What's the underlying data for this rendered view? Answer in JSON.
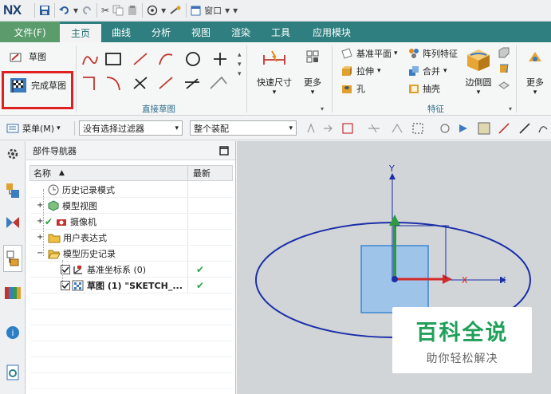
{
  "app": {
    "logo": "NX"
  },
  "quick_access": {
    "window_menu": "窗口"
  },
  "tabs": [
    {
      "label": "文件(F)"
    },
    {
      "label": "主页"
    },
    {
      "label": "曲线"
    },
    {
      "label": "分析"
    },
    {
      "label": "视图"
    },
    {
      "label": "渲染"
    },
    {
      "label": "工具"
    },
    {
      "label": "应用模块"
    }
  ],
  "ribbon": {
    "sketch_label": "草图",
    "finish_sketch_label": "完成草图",
    "quick_dimension_label": "快速尺寸",
    "more_label_1": "更多",
    "group_direct_sketch": "直接草图",
    "datum_plane_label": "基准平面",
    "pattern_feature_label": "阵列特征",
    "extrude_label": "拉伸",
    "unite_label": "合并",
    "hole_label": "孔",
    "shell_label": "抽壳",
    "edge_blend_label": "边倒圆",
    "more_label_2": "更多",
    "group_feature": "特征",
    "colors": {
      "highlight_border": "#e02020",
      "tab_bar": "#2f7f80",
      "file_tab": "#5a9c6c"
    }
  },
  "toolbar": {
    "menu_label": "菜单(M)",
    "filter_value": "没有选择过滤器",
    "assembly_value": "整个装配"
  },
  "navigator": {
    "title": "部件导航器",
    "col_name": "名称",
    "col_latest": "最新",
    "rows": [
      {
        "label": "历史记录模式",
        "icon": "clock-icon"
      },
      {
        "label": "模型视图",
        "icon": "model-views-icon"
      },
      {
        "label": "摄像机",
        "icon": "camera-icon"
      },
      {
        "label": "用户表达式",
        "icon": "folder-icon"
      },
      {
        "label": "模型历史记录",
        "icon": "folder-open-icon"
      },
      {
        "label": "基准坐标系 (0)",
        "icon": "datum-csys-icon",
        "latest": "✔"
      },
      {
        "label": "草图 (1) \"SKETCH_...",
        "icon": "sketch-icon",
        "latest": "✔"
      }
    ]
  },
  "viewport": {
    "axis_labels": {
      "y": "Y",
      "x": "X",
      "x2": "X"
    }
  },
  "watermark": {
    "title": "百科全说",
    "subtitle": "助你轻松解决",
    "color": "#21a05a"
  }
}
